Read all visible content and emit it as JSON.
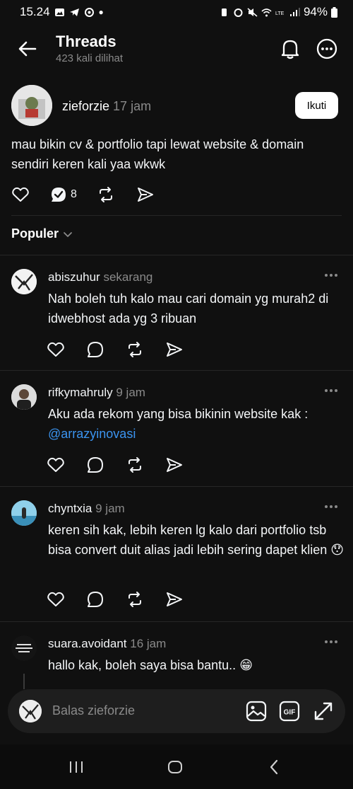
{
  "status_bar": {
    "time": "15.24",
    "battery": "94%"
  },
  "header": {
    "title": "Threads",
    "subtitle": "423 kali dilihat"
  },
  "main_post": {
    "username": "zieforzie",
    "time": "17 jam",
    "follow_label": "Ikuti",
    "text": "mau bikin cv & portfolio tapi lewat website & domain sendiri keren kali yaa wkwk",
    "reply_count": "8"
  },
  "sort": {
    "label": "Populer"
  },
  "replies": [
    {
      "username": "abiszuhur",
      "time": "sekarang",
      "text": "Nah boleh tuh kalo mau cari domain yg murah2 di idwebhost ada yg 3 ribuan"
    },
    {
      "username": "rifkymahruly",
      "time": "9 jam",
      "text": "Aku ada rekom yang bisa bikinin website kak :",
      "mention": "@arrazyinovasi"
    },
    {
      "username": "chyntxia",
      "time": "9 jam",
      "text": "keren sih kak, lebih keren lg kalo dari portfolio tsb bisa convert duit alias jadi lebih sering dapet klien",
      "emoji": "😯"
    },
    {
      "username": "suara.avoidant",
      "time": "16 jam",
      "text": "hallo kak, boleh saya bisa bantu..",
      "emoji": "😁"
    }
  ],
  "reply_bar": {
    "placeholder": "Balas zieforzie",
    "gif_label": "GIF"
  },
  "icons": {
    "back": "arrow-left-icon",
    "bell": "bell-icon",
    "more": "more-horizontal-icon",
    "like": "heart-icon",
    "comment": "comment-icon",
    "repost": "repost-icon",
    "share": "send-icon",
    "image": "image-icon",
    "gif": "gif-icon",
    "expand": "expand-icon"
  },
  "colors": {
    "background": "#101010",
    "text": "#f3f5f7",
    "muted": "#8a8a8a",
    "mention": "#3b94f0",
    "follow_bg": "#ffffff"
  }
}
